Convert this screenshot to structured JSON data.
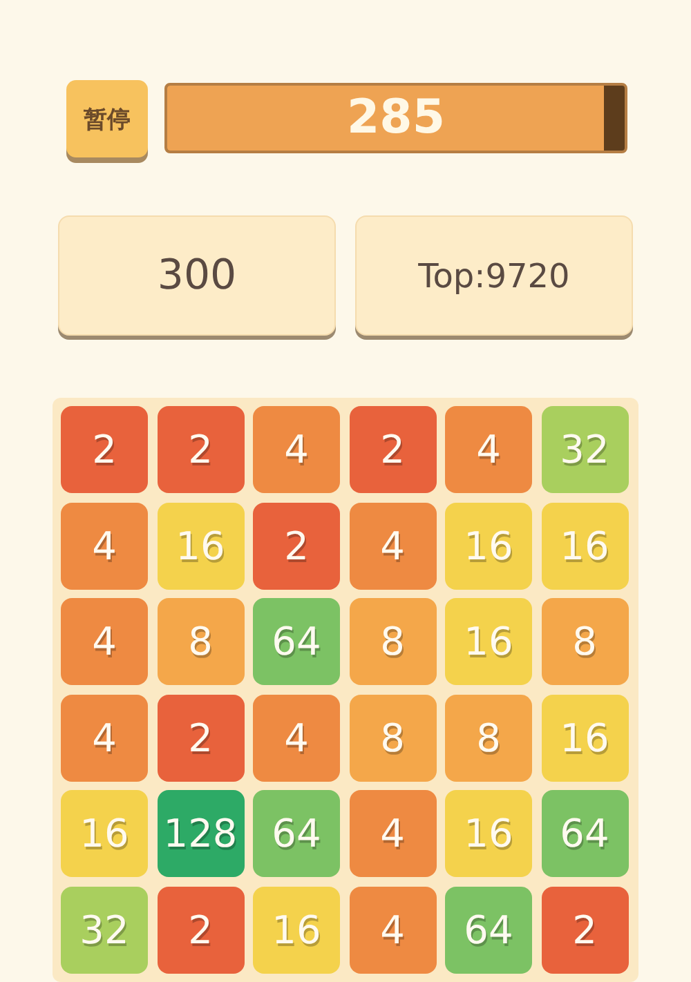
{
  "pause_button": {
    "label": "暂停"
  },
  "timer": {
    "reading": "285",
    "level": 0.955
  },
  "scores": [
    {
      "label": "300"
    },
    {
      "label": "Top:9720"
    }
  ],
  "board": {
    "rows": [
      [
        {
          "value": "2",
          "color": "#e8623c"
        },
        {
          "value": "2",
          "color": "#e8623c"
        },
        {
          "value": "4",
          "color": "#ee8a42"
        },
        {
          "value": "2",
          "color": "#e8623c"
        },
        {
          "value": "4",
          "color": "#ee8a42"
        },
        {
          "value": "32",
          "color": "#a9cf5e"
        }
      ],
      [
        {
          "value": "4",
          "color": "#ee8a42"
        },
        {
          "value": "16",
          "color": "#f4d24c"
        },
        {
          "value": "2",
          "color": "#e8623c"
        },
        {
          "value": "4",
          "color": "#ee8a42"
        },
        {
          "value": "16",
          "color": "#f4d24c"
        },
        {
          "value": "16",
          "color": "#f4d24c"
        }
      ],
      [
        {
          "value": "4",
          "color": "#ee8a42"
        },
        {
          "value": "8",
          "color": "#f4a74a"
        },
        {
          "value": "64",
          "color": "#7cc264"
        },
        {
          "value": "8",
          "color": "#f4a74a"
        },
        {
          "value": "16",
          "color": "#f4d24c"
        },
        {
          "value": "8",
          "color": "#f4a74a"
        }
      ],
      [
        {
          "value": "4",
          "color": "#ee8a42"
        },
        {
          "value": "2",
          "color": "#e8623c"
        },
        {
          "value": "4",
          "color": "#ee8a42"
        },
        {
          "value": "8",
          "color": "#f4a74a"
        },
        {
          "value": "8",
          "color": "#f4a74a"
        },
        {
          "value": "16",
          "color": "#f4d24c"
        }
      ],
      [
        {
          "value": "16",
          "color": "#f4d24c"
        },
        {
          "value": "128",
          "color": "#2daa66"
        },
        {
          "value": "64",
          "color": "#7cc264"
        },
        {
          "value": "4",
          "color": "#ee8a42"
        },
        {
          "value": "16",
          "color": "#f4d24c"
        },
        {
          "value": "64",
          "color": "#7cc264"
        }
      ],
      [
        {
          "value": "32",
          "color": "#a9cf5e"
        },
        {
          "value": "2",
          "color": "#e8623c"
        },
        {
          "value": "16",
          "color": "#f4d24c"
        },
        {
          "value": "4",
          "color": "#ee8a42"
        },
        {
          "value": "64",
          "color": "#7cc264"
        },
        {
          "value": "2",
          "color": "#e8623c"
        }
      ]
    ]
  }
}
